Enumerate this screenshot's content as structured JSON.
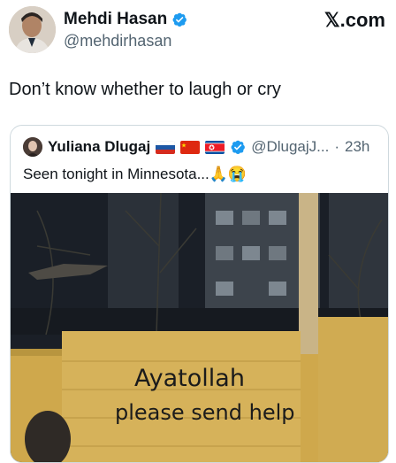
{
  "author": {
    "name": "Mehdi Hasan",
    "handle": "@mehdirhasan",
    "verified": true
  },
  "brand": "𝕏.com",
  "tweet": {
    "text": "Don’t know whether to laugh or cry"
  },
  "quoted": {
    "name": "Yuliana Dlugaj",
    "flags": [
      "russia-flag-icon",
      "china-flag-icon",
      "north-korea-flag-icon"
    ],
    "verified": true,
    "handle": "@DlugajJ...",
    "separator": "·",
    "time": "23h",
    "text": "Seen tonight in Minnesota...🙏😭",
    "image": {
      "graffiti_line1": "Ayatollah",
      "graffiti_line2": "please send help"
    }
  },
  "colors": {
    "verified": "#1d9bf0",
    "secondary_text": "#536471",
    "border": "#cfd9de"
  }
}
